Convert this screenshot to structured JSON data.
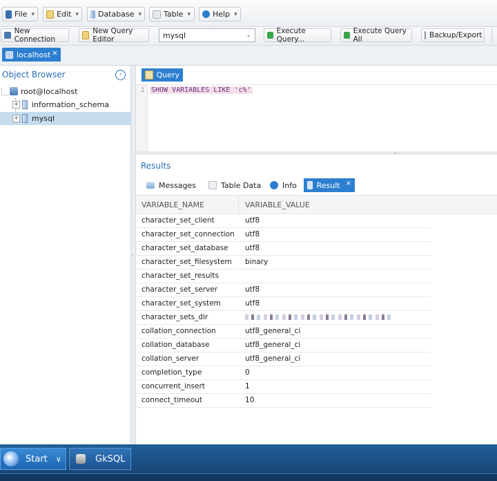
{
  "menubar": {
    "file": "File",
    "edit": "Edit",
    "database": "Database",
    "table": "Table",
    "help": "Help"
  },
  "toolbar": {
    "new_connection": "New Connection",
    "new_query_editor": "New Query Editor",
    "database_selected": "mysql",
    "execute_query": "Execute Query...",
    "execute_query_all": "Execute Query All",
    "backup_export": "Backup/Export"
  },
  "connection_tab": {
    "label": "localhost",
    "close": "×"
  },
  "object_browser": {
    "title": "Object Browser",
    "root": "root@localhost",
    "items": [
      {
        "label": "information_schema"
      },
      {
        "label": "mysql"
      }
    ]
  },
  "query": {
    "tab_label": "Query",
    "line_number": "1",
    "sql": "SHOW VARIABLES LIKE 'c%'"
  },
  "results": {
    "title": "Results",
    "tabs": [
      "Messages",
      "Table Data",
      "Info",
      "Result"
    ],
    "close": "×",
    "columns": [
      "VARIABLE_NAME",
      "VARIABLE_VALUE"
    ],
    "rows": [
      [
        "character_set_client",
        "utf8"
      ],
      [
        "character_set_connection",
        "utf8"
      ],
      [
        "character_set_database",
        "utf8"
      ],
      [
        "character_set_filesystem",
        "binary"
      ],
      [
        "character_set_results",
        ""
      ],
      [
        "character_set_server",
        "utf8"
      ],
      [
        "character_set_system",
        "utf8"
      ],
      [
        "character_sets_dir",
        ""
      ],
      [
        "collation_connection",
        "utf8_general_ci"
      ],
      [
        "collation_database",
        "utf8_general_ci"
      ],
      [
        "collation_server",
        "utf8_general_ci"
      ],
      [
        "completion_type",
        "0"
      ],
      [
        "concurrent_insert",
        "1"
      ],
      [
        "connect_timeout",
        "10"
      ]
    ]
  },
  "taskbar": {
    "start": "Start",
    "app": "GkSQL"
  },
  "colors": {
    "accent": "#2c7fd0",
    "panel_title": "#2a6fb5",
    "selection": "#c6dcef",
    "taskbar": "#1f5f97"
  }
}
